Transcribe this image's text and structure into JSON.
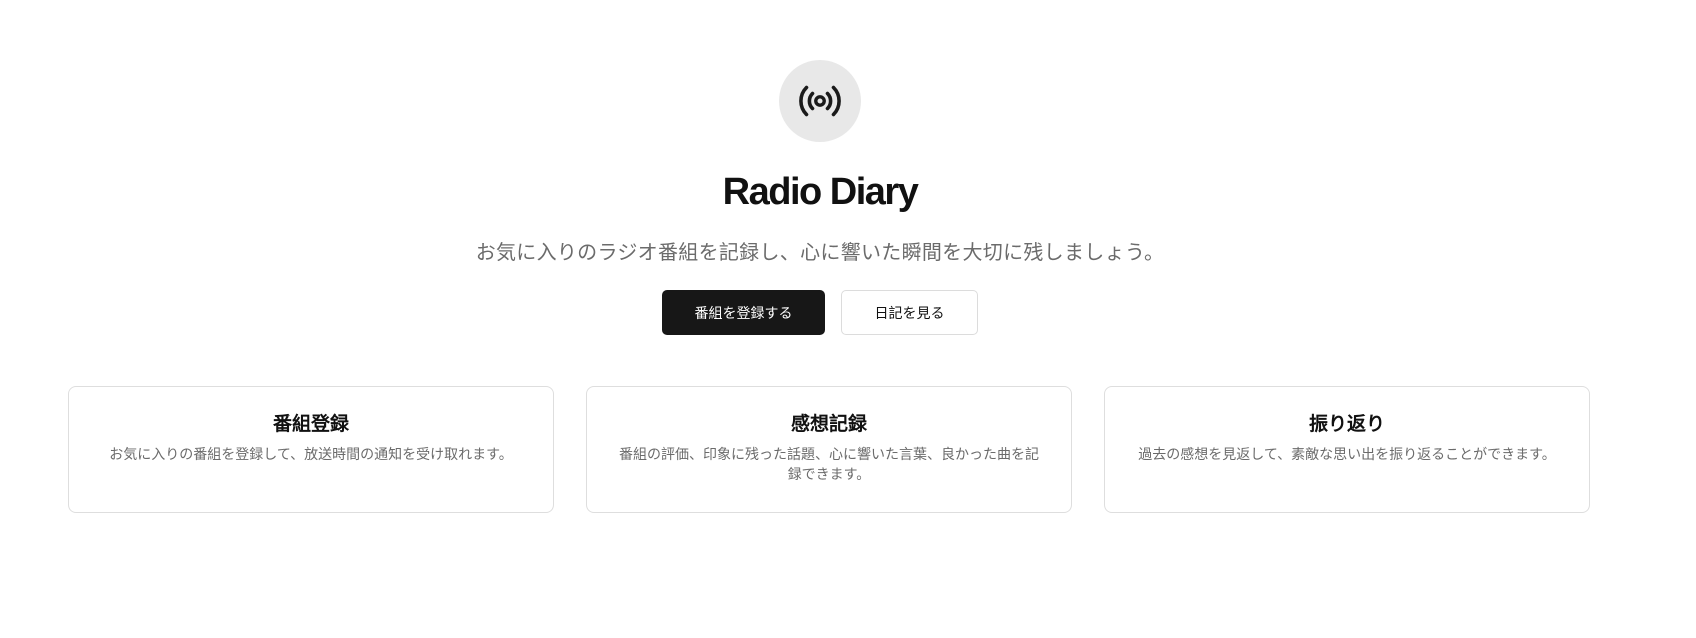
{
  "app": {
    "title": "Radio Diary",
    "tagline": "お気に入りのラジオ番組を記録し、心に響いた瞬間を大切に残しましょう。",
    "logo_icon": "radio-broadcast-icon",
    "logo_bg": "#e8e8e8"
  },
  "actions": {
    "primary_label": "番組を登録する",
    "secondary_label": "日記を見る"
  },
  "features": [
    {
      "title": "番組登録",
      "description": "お気に入りの番組を登録して、放送時間の通知を受け取れます。"
    },
    {
      "title": "感想記録",
      "description": "番組の評価、印象に残った話題、心に響いた言葉、良かった曲を記録できます。"
    },
    {
      "title": "振り返り",
      "description": "過去の感想を見返して、素敵な思い出を振り返ることができます。"
    }
  ],
  "colors": {
    "primary_button": "#171717",
    "text": "#111111",
    "muted_text": "#6b6b6b",
    "border": "#dedede"
  }
}
